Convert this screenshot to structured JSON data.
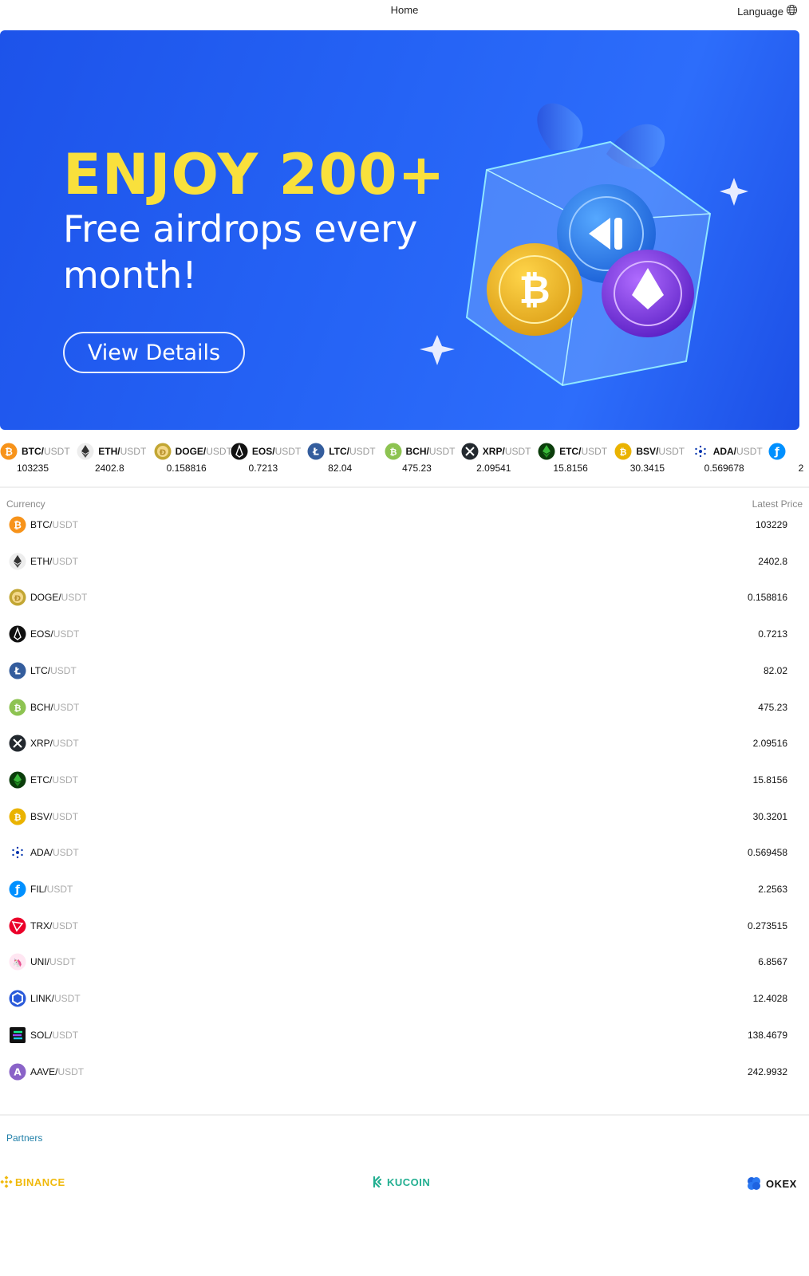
{
  "header": {
    "home_label": "Home",
    "language_label": "Language",
    "language_icon": "globe-icon"
  },
  "banner": {
    "headline": "ENJOY 200+",
    "subheadline": "Free airdrops every month!",
    "button_label": "View Details",
    "carousel_total": 3,
    "carousel_active": 2,
    "colors": {
      "background": "#2563f5",
      "headline": "#f9e03c"
    }
  },
  "ticker": [
    {
      "base": "BTC/",
      "quote": "USDT",
      "price": "103235",
      "icon": "btc-icon"
    },
    {
      "base": "ETH/",
      "quote": "USDT",
      "price": "2402.8",
      "icon": "eth-icon"
    },
    {
      "base": "DOGE/",
      "quote": "USDT",
      "price": "0.158816",
      "icon": "doge-icon"
    },
    {
      "base": "EOS/",
      "quote": "USDT",
      "price": "0.7213",
      "icon": "eos-icon"
    },
    {
      "base": "LTC/",
      "quote": "USDT",
      "price": "82.04",
      "icon": "ltc-icon"
    },
    {
      "base": "BCH/",
      "quote": "USDT",
      "price": "475.23",
      "icon": "bch-icon"
    },
    {
      "base": "XRP/",
      "quote": "USDT",
      "price": "2.09541",
      "icon": "xrp-icon"
    },
    {
      "base": "ETC/",
      "quote": "USDT",
      "price": "15.8156",
      "icon": "etc-icon"
    },
    {
      "base": "BSV/",
      "quote": "USDT",
      "price": "30.3415",
      "icon": "bsv-icon"
    },
    {
      "base": "ADA/",
      "quote": "USDT",
      "price": "0.569678",
      "icon": "ada-icon"
    },
    {
      "base": "",
      "quote": "",
      "price": "2",
      "icon": "fil-icon"
    }
  ],
  "table": {
    "col_currency": "Currency",
    "col_price": "Latest Price",
    "rows": [
      {
        "base": "BTC/",
        "quote": "USDT",
        "price": "103229",
        "icon": "btc-icon"
      },
      {
        "base": "ETH/",
        "quote": "USDT",
        "price": "2402.8",
        "icon": "eth-icon"
      },
      {
        "base": "DOGE/",
        "quote": "USDT",
        "price": "0.158816",
        "icon": "doge-icon"
      },
      {
        "base": "EOS/",
        "quote": "USDT",
        "price": "0.7213",
        "icon": "eos-icon"
      },
      {
        "base": "LTC/",
        "quote": "USDT",
        "price": "82.02",
        "icon": "ltc-icon"
      },
      {
        "base": "BCH/",
        "quote": "USDT",
        "price": "475.23",
        "icon": "bch-icon"
      },
      {
        "base": "XRP/",
        "quote": "USDT",
        "price": "2.09516",
        "icon": "xrp-icon"
      },
      {
        "base": "ETC/",
        "quote": "USDT",
        "price": "15.8156",
        "icon": "etc-icon"
      },
      {
        "base": "BSV/",
        "quote": "USDT",
        "price": "30.3201",
        "icon": "bsv-icon"
      },
      {
        "base": "ADA/",
        "quote": "USDT",
        "price": "0.569458",
        "icon": "ada-icon"
      },
      {
        "base": "FIL/",
        "quote": "USDT",
        "price": "2.2563",
        "icon": "fil-icon"
      },
      {
        "base": "TRX/",
        "quote": "USDT",
        "price": "0.273515",
        "icon": "trx-icon"
      },
      {
        "base": "UNI/",
        "quote": "USDT",
        "price": "6.8567",
        "icon": "uni-icon"
      },
      {
        "base": "LINK/",
        "quote": "USDT",
        "price": "12.4028",
        "icon": "link-icon"
      },
      {
        "base": "SOL/",
        "quote": "USDT",
        "price": "138.4679",
        "icon": "sol-icon"
      },
      {
        "base": "AAVE/",
        "quote": "USDT",
        "price": "242.9932",
        "icon": "aave-icon"
      }
    ]
  },
  "partners": {
    "title": "Partners",
    "items": [
      {
        "name": "BINANCE",
        "icon": "binance-logo-icon",
        "color": "#f0b90b"
      },
      {
        "name": "KUCOIN",
        "icon": "kucoin-logo-icon",
        "color": "#23af91"
      },
      {
        "name": "OKEX",
        "icon": "okex-logo-icon",
        "color": "#111111"
      }
    ]
  }
}
